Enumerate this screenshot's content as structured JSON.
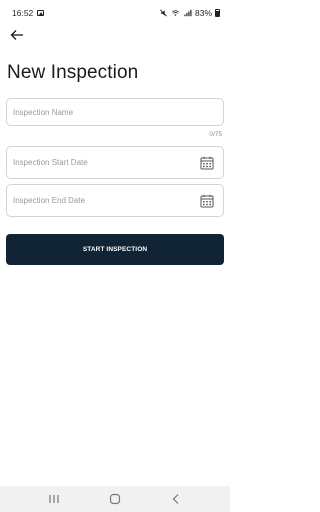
{
  "status_bar": {
    "time": "16:52",
    "battery_text": "83%",
    "icons": [
      "gallery-icon",
      "mute-icon",
      "wifi-icon",
      "signal-icon",
      "battery-icon"
    ]
  },
  "header": {
    "back_icon": "arrow-left-icon",
    "title": "New Inspection"
  },
  "form": {
    "name_field": {
      "placeholder": "Inspection Name",
      "value": "",
      "counter": "0/75"
    },
    "start_date_field": {
      "placeholder": "Inspection Start Date",
      "value": "",
      "icon": "calendar-icon"
    },
    "end_date_field": {
      "placeholder": "Inspection End Date",
      "value": "",
      "icon": "calendar-icon"
    },
    "submit_label": "START INSPECTION"
  },
  "nav_bar": {
    "items": [
      "recent-apps-icon",
      "home-icon",
      "back-icon"
    ]
  },
  "colors": {
    "primary_button": "#102436",
    "field_border": "#d4d4d4",
    "placeholder": "#9a9a9a",
    "nav_background": "#f1f1f1"
  }
}
